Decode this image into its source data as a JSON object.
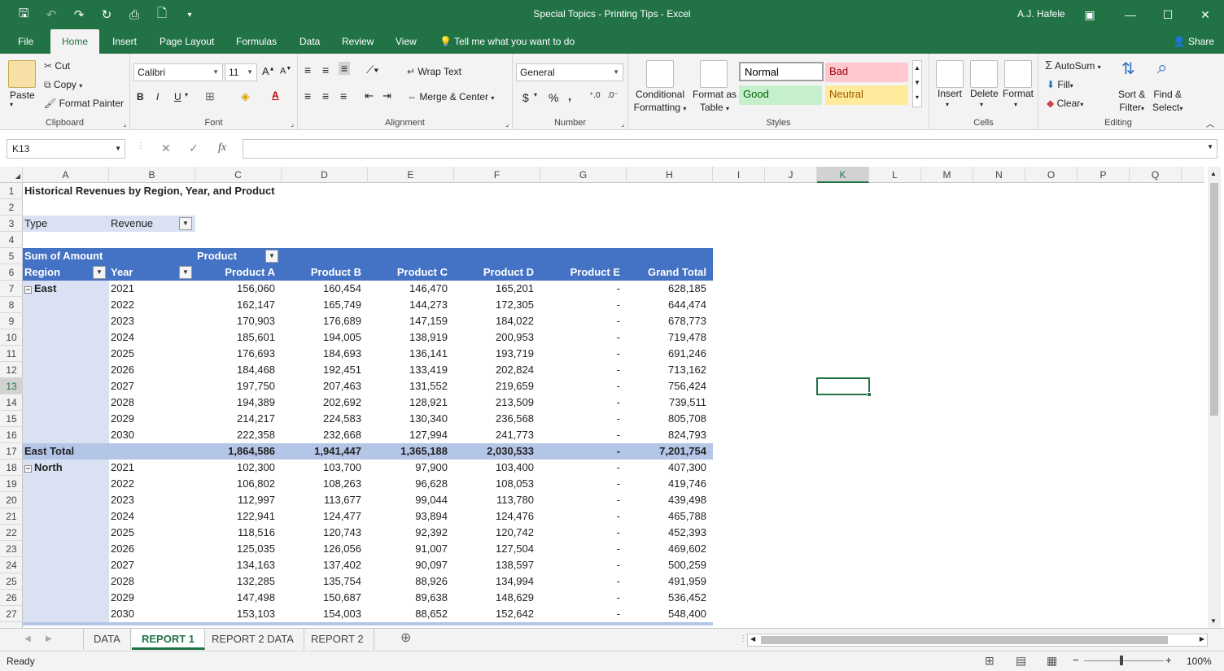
{
  "app": {
    "title": "Special Topics - Printing Tips  -  Excel",
    "user": "A.J. Hafele",
    "colors": {
      "brand": "#217346",
      "pivot_header": "#4472c4",
      "pivot_total": "#b4c6e7",
      "pivot_region": "#d9e1f2"
    }
  },
  "tabs": [
    "File",
    "Home",
    "Insert",
    "Page Layout",
    "Formulas",
    "Data",
    "Review",
    "View"
  ],
  "tell_me": "Tell me what you want to do",
  "share": "Share",
  "ribbon": {
    "clipboard": {
      "paste": "Paste",
      "cut": "Cut",
      "copy": "Copy",
      "format_painter": "Format Painter",
      "label": "Clipboard"
    },
    "font": {
      "name": "Calibri",
      "size": "11",
      "label": "Font",
      "bold": "B",
      "italic": "I",
      "underline": "U"
    },
    "alignment": {
      "wrap": "Wrap Text",
      "merge": "Merge & Center",
      "label": "Alignment"
    },
    "number": {
      "format": "General",
      "currency": "$",
      "percent": "%",
      "comma": ",",
      "label": "Number"
    },
    "styles": {
      "conditional": "Conditional Formatting",
      "conditional_l1": "Conditional",
      "conditional_l2": "Formatting",
      "format_table_l1": "Format as",
      "format_table_l2": "Table",
      "normal": "Normal",
      "bad": "Bad",
      "good": "Good",
      "neutral": "Neutral",
      "label": "Styles"
    },
    "cells": {
      "insert": "Insert",
      "delete": "Delete",
      "format": "Format",
      "label": "Cells"
    },
    "editing": {
      "autosum": "AutoSum",
      "fill": "Fill",
      "clear": "Clear",
      "sort_l1": "Sort &",
      "sort_l2": "Filter",
      "find_l1": "Find &",
      "find_l2": "Select",
      "label": "Editing"
    }
  },
  "formula_bar": {
    "name_box": "K13",
    "fx": "fx",
    "value": ""
  },
  "columns": [
    "A",
    "B",
    "C",
    "D",
    "E",
    "F",
    "G",
    "H",
    "I",
    "J",
    "K",
    "L",
    "M",
    "N",
    "O",
    "P",
    "Q"
  ],
  "rows": [
    "1",
    "2",
    "3",
    "4",
    "5",
    "6",
    "7",
    "8",
    "9",
    "10",
    "11",
    "12",
    "13",
    "14",
    "15",
    "16",
    "17",
    "18",
    "19",
    "20",
    "21",
    "22",
    "23",
    "24",
    "25",
    "26",
    "27"
  ],
  "sheet": {
    "title": "Historical Revenues by Region, Year, and Product",
    "filter_label": "Type",
    "filter_value": "Revenue",
    "pivot_corner": "Sum of Amount",
    "col_field": "Product",
    "row_field1": "Region",
    "row_field2": "Year",
    "headers": [
      "Product A",
      "Product B",
      "Product C",
      "Product D",
      "Product E",
      "Grand Total"
    ],
    "east": {
      "name": "East",
      "rows": [
        [
          "2021",
          "156,060",
          "160,454",
          "146,470",
          "165,201",
          "-",
          "628,185"
        ],
        [
          "2022",
          "162,147",
          "165,749",
          "144,273",
          "172,305",
          "-",
          "644,474"
        ],
        [
          "2023",
          "170,903",
          "176,689",
          "147,159",
          "184,022",
          "-",
          "678,773"
        ],
        [
          "2024",
          "185,601",
          "194,005",
          "138,919",
          "200,953",
          "-",
          "719,478"
        ],
        [
          "2025",
          "176,693",
          "184,693",
          "136,141",
          "193,719",
          "-",
          "691,246"
        ],
        [
          "2026",
          "184,468",
          "192,451",
          "133,419",
          "202,824",
          "-",
          "713,162"
        ],
        [
          "2027",
          "197,750",
          "207,463",
          "131,552",
          "219,659",
          "-",
          "756,424"
        ],
        [
          "2028",
          "194,389",
          "202,692",
          "128,921",
          "213,509",
          "-",
          "739,511"
        ],
        [
          "2029",
          "214,217",
          "224,583",
          "130,340",
          "236,568",
          "-",
          "805,708"
        ],
        [
          "2030",
          "222,358",
          "232,668",
          "127,994",
          "241,773",
          "-",
          "824,793"
        ]
      ],
      "total_label": "East Total",
      "total": [
        "1,864,586",
        "1,941,447",
        "1,365,188",
        "2,030,533",
        "-",
        "7,201,754"
      ]
    },
    "north": {
      "name": "North",
      "rows": [
        [
          "2021",
          "102,300",
          "103,700",
          "97,900",
          "103,400",
          "-",
          "407,300"
        ],
        [
          "2022",
          "106,802",
          "108,263",
          "96,628",
          "108,053",
          "-",
          "419,746"
        ],
        [
          "2023",
          "112,997",
          "113,677",
          "99,044",
          "113,780",
          "-",
          "439,498"
        ],
        [
          "2024",
          "122,941",
          "124,477",
          "93,894",
          "124,476",
          "-",
          "465,788"
        ],
        [
          "2025",
          "118,516",
          "120,743",
          "92,392",
          "120,742",
          "-",
          "452,393"
        ],
        [
          "2026",
          "125,035",
          "126,056",
          "91,007",
          "127,504",
          "-",
          "469,602"
        ],
        [
          "2027",
          "134,163",
          "137,402",
          "90,097",
          "138,597",
          "-",
          "500,259"
        ],
        [
          "2028",
          "132,285",
          "135,754",
          "88,926",
          "134,994",
          "-",
          "491,959"
        ],
        [
          "2029",
          "147,498",
          "150,687",
          "89,638",
          "148,629",
          "-",
          "536,452"
        ],
        [
          "2030",
          "153,103",
          "154,003",
          "88,652",
          "152,642",
          "-",
          "548,400"
        ]
      ]
    }
  },
  "sheet_tabs": [
    "DATA",
    "REPORT 1",
    "REPORT 2 DATA",
    "REPORT 2"
  ],
  "active_sheet": "REPORT 1",
  "status": {
    "ready": "Ready",
    "zoom": "100%"
  }
}
